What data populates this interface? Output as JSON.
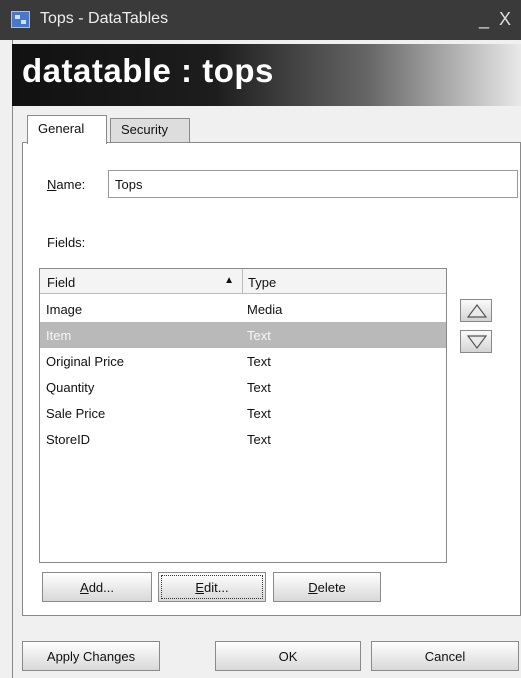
{
  "window": {
    "title": "Tops - DataTables",
    "minimize": "_",
    "close": "X"
  },
  "banner": {
    "text": "datatable : tops"
  },
  "tabs": [
    {
      "label": "General"
    },
    {
      "label": "Security"
    }
  ],
  "form": {
    "name_label_first": "N",
    "name_label_rest": "ame:",
    "name_value": "Tops",
    "fields_label": "Fields:"
  },
  "grid": {
    "columns": [
      {
        "label": "Field",
        "sort": "▲"
      },
      {
        "label": "Type"
      }
    ],
    "rows": [
      {
        "field": "Image",
        "type": "Media"
      },
      {
        "field": "Item",
        "type": "Text"
      },
      {
        "field": "Original Price",
        "type": "Text"
      },
      {
        "field": "Quantity",
        "type": "Text"
      },
      {
        "field": "Sale Price",
        "type": "Text"
      },
      {
        "field": "StoreID",
        "type": "Text"
      }
    ],
    "selected_row": "Item"
  },
  "buttons": {
    "add_first": "A",
    "add_rest": "dd...",
    "edit_first": "E",
    "edit_rest": "dit...",
    "delete_first": "D",
    "delete_rest": "elete",
    "apply": "Apply Changes",
    "ok": "OK",
    "cancel": "Cancel"
  },
  "icons": {
    "move_up": "triangle-up-icon",
    "move_down": "triangle-down-icon",
    "app": "datatables-icon"
  }
}
